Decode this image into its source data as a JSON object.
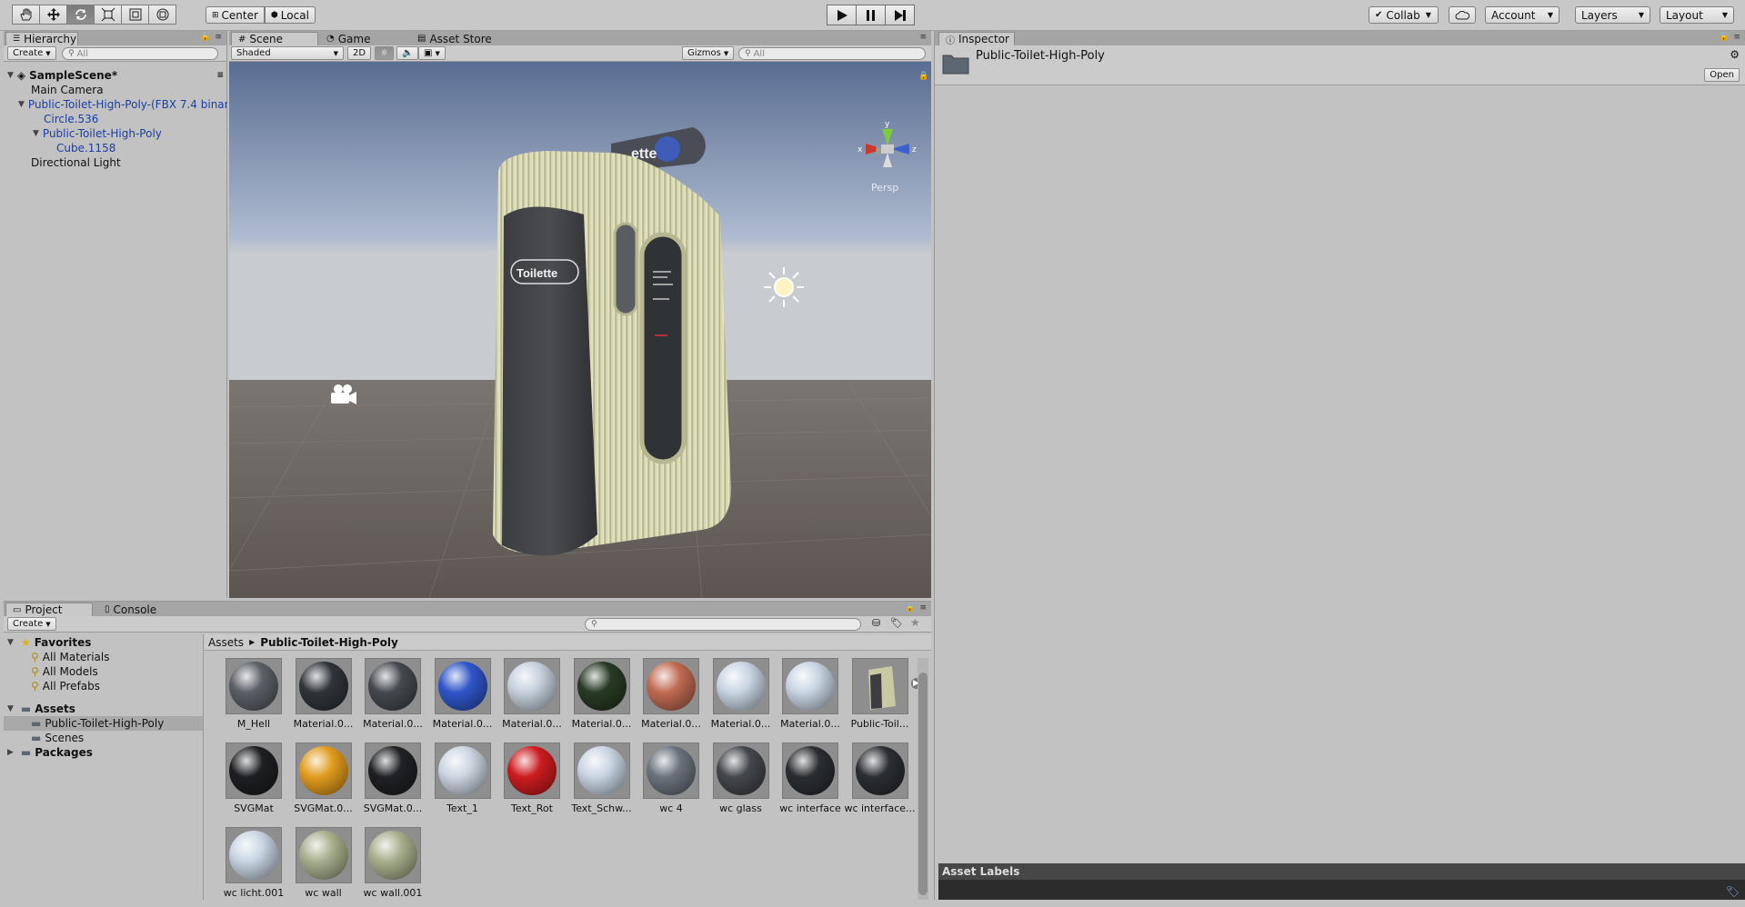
{
  "toolbar": {
    "tools": [
      "hand-tool",
      "move-tool",
      "rotate-tool",
      "scale-tool",
      "rect-tool",
      "transform-tool"
    ],
    "pivot_label": "Center",
    "space_label": "Local",
    "collab_label": "Collab",
    "account_label": "Account",
    "layers_label": "Layers",
    "layout_label": "Layout"
  },
  "hierarchy": {
    "tab": "Hierarchy",
    "create_label": "Create",
    "search_placeholder": "All",
    "scene_name": "SampleScene*",
    "items": [
      {
        "label": "Main Camera"
      },
      {
        "label": "Public-Toilet-High-Poly-(FBX 7.4 binar"
      },
      {
        "label": "Circle.536"
      },
      {
        "label": "Public-Toilet-High-Poly"
      },
      {
        "label": "Cube.1158"
      },
      {
        "label": "Directional Light"
      }
    ]
  },
  "scene": {
    "tabs": [
      "Scene",
      "Game",
      "Asset Store"
    ],
    "shading": "Shaded",
    "mode_2d": "2D",
    "gizmos": "Gizmos",
    "search_placeholder": "All",
    "persp_label": "Persp",
    "axis_labels": [
      "y",
      "x",
      "z"
    ],
    "sign_text": "Toilette",
    "sign_text_top": "ette"
  },
  "inspector": {
    "tab": "Inspector",
    "asset_name": "Public-Toilet-High-Poly",
    "open_label": "Open",
    "asset_labels_title": "Asset Labels"
  },
  "project": {
    "tabs": [
      "Project",
      "Console"
    ],
    "create_label": "Create",
    "favorites": {
      "title": "Favorites",
      "items": [
        "All Materials",
        "All Models",
        "All Prefabs"
      ]
    },
    "assets": {
      "title": "Assets",
      "items": [
        "Public-Toilet-High-Poly",
        "Scenes"
      ]
    },
    "packages_title": "Packages",
    "breadcrumb": [
      "Assets",
      "Public-Toilet-High-Poly"
    ],
    "grid": [
      {
        "label": "M_Hell",
        "color": "#5b5f66"
      },
      {
        "label": "Material.0...",
        "color": "#30343a"
      },
      {
        "label": "Material.0...",
        "color": "#45494f"
      },
      {
        "label": "Material.0...",
        "color": "#2f55c9"
      },
      {
        "label": "Material.0...",
        "color": "#c6d0dc"
      },
      {
        "label": "Material.0...",
        "color": "#283a25"
      },
      {
        "label": "Material.0...",
        "color": "#c06a52"
      },
      {
        "label": "Material.0...",
        "color": "#c9d5e3"
      },
      {
        "label": "Material.0...",
        "color": "#c9d5e3"
      },
      {
        "label": "Public-Toil...",
        "color": "model"
      },
      {
        "label": "SVGMat",
        "color": "#1d1f22"
      },
      {
        "label": "SVGMat.0...",
        "color": "#e19c1e"
      },
      {
        "label": "SVGMat.0...",
        "color": "#1f2124"
      },
      {
        "label": "Text_1",
        "color": "#ccd5e0"
      },
      {
        "label": "Text_Rot",
        "color": "#cc1c20"
      },
      {
        "label": "Text_Schw...",
        "color": "#c9d5e3"
      },
      {
        "label": "wc 4",
        "color": "#6b737d"
      },
      {
        "label": "wc glass",
        "color": "#44474c"
      },
      {
        "label": "wc interface",
        "color": "#2b2e32"
      },
      {
        "label": "wc interface...",
        "color": "#2b2e32"
      },
      {
        "label": "wc licht.001",
        "color": "#c9d5e3"
      },
      {
        "label": "wc wall",
        "color": "#a7ae8c"
      },
      {
        "label": "wc wall.001",
        "color": "#a7ae8c"
      }
    ]
  }
}
